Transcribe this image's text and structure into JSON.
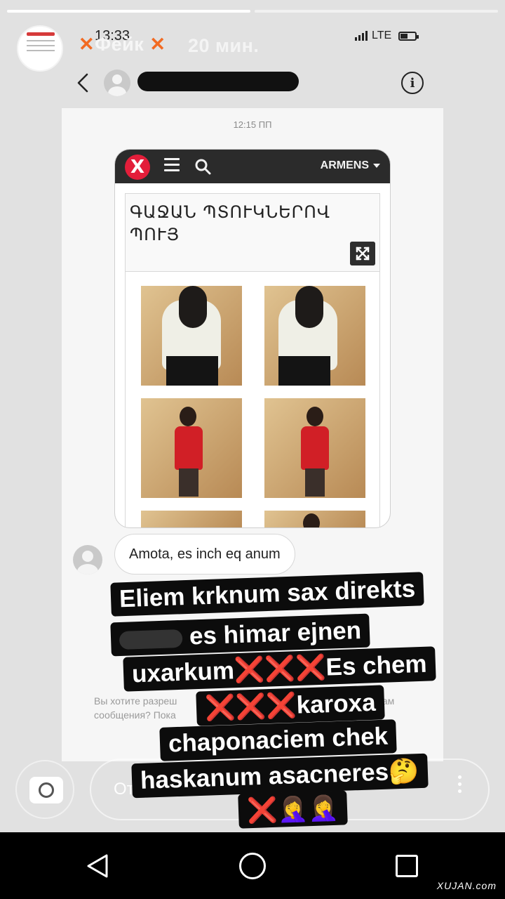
{
  "story": {
    "username": "Фейк",
    "username_mark": "✕",
    "time_ago": "20 мин.",
    "progress_segments_done": 1,
    "progress_segments_total": 2
  },
  "device": {
    "clock": "13:33",
    "network": "LTE"
  },
  "dm": {
    "timestamp": "12:15 ПП",
    "info_icon": "i"
  },
  "shared_site": {
    "logo_letter": "X",
    "country": "ARMENS",
    "title": "ԳԱՋԱՆ ՊՏՈՒԿՆԵՐՈՎ ՊՈՒՅ"
  },
  "message": {
    "text": "Amota, es inch eq anum"
  },
  "request": {
    "line1": "Вы хотите разреш",
    "line2": "сообщения? Пока",
    "line3": "ть вам"
  },
  "reply": {
    "placeholder": "Отправить сообщение"
  },
  "caption": {
    "line1": "Eliem krknum sax direkts",
    "line2": "es himar ejnen",
    "line3a": "uxarkum",
    "line3b": "Es chem",
    "line4": "karoxa",
    "line5": "chaponaciem chek",
    "line6": "haskanum asacneres🤔",
    "cross": "❌❌❌",
    "cross_single": "❌",
    "emoji_end": "🤦‍♀️🤦‍♀️"
  },
  "watermark": "XUJAN.com",
  "colors": {
    "accent_x": "#f26a22",
    "logo_red": "#e31e3a",
    "caption_bg": "#0c0c0c",
    "caption_cross": "#e01d1d"
  }
}
